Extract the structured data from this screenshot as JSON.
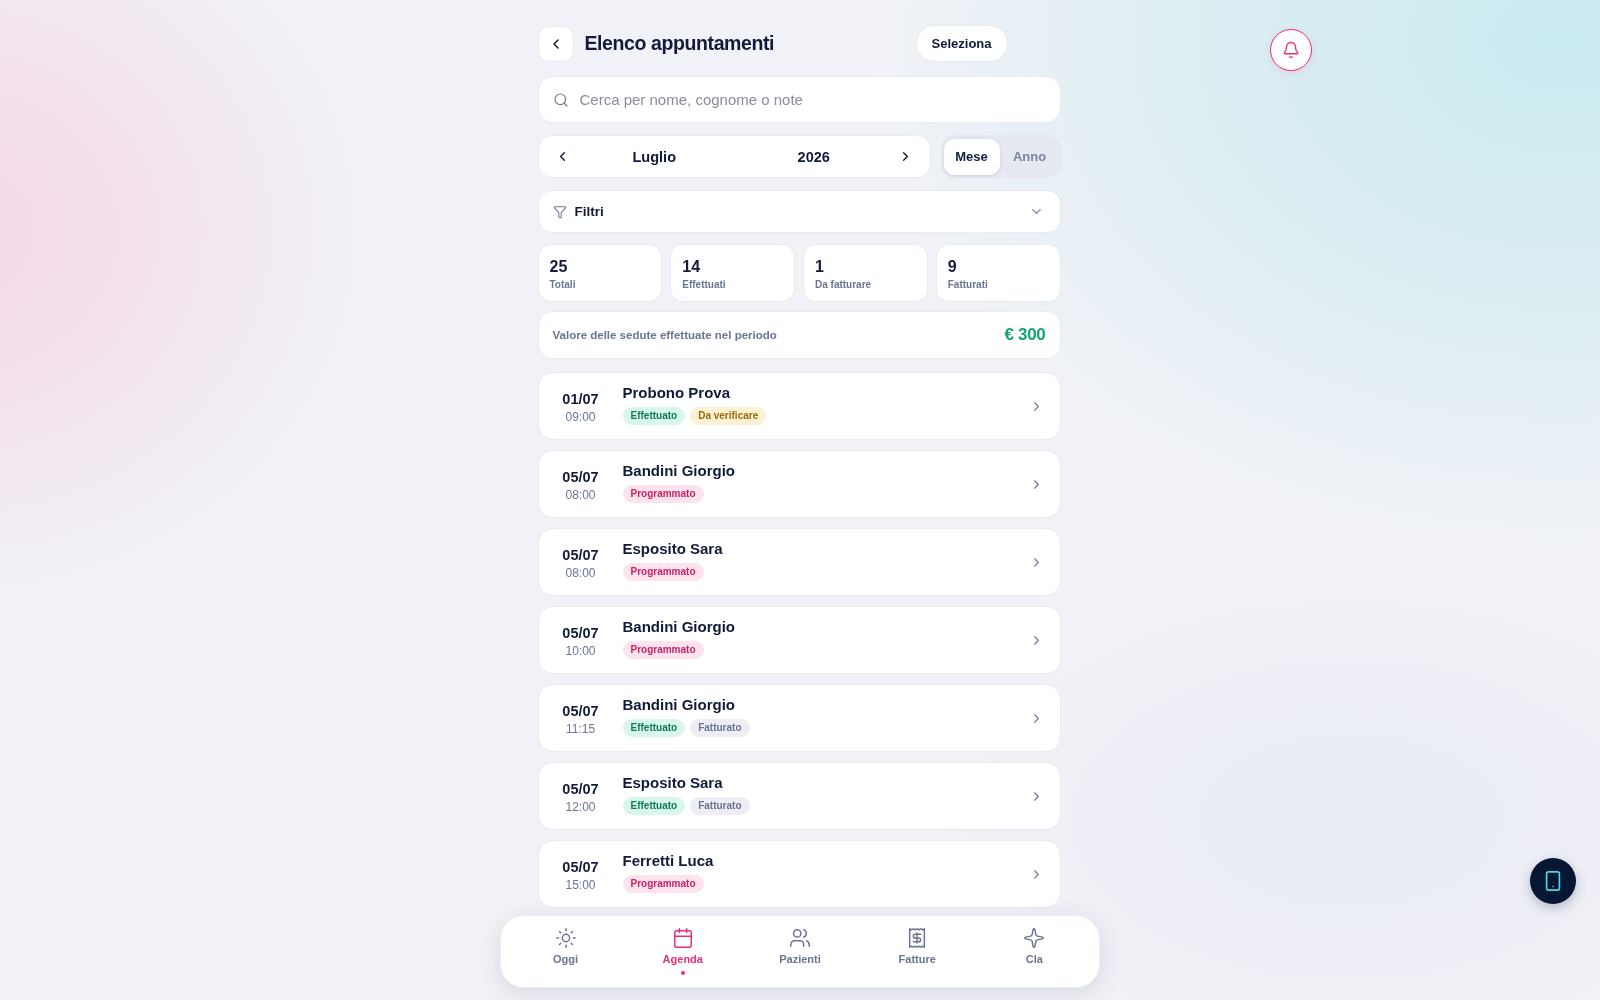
{
  "header": {
    "title": "Elenco appuntamenti",
    "select_button": "Seleziona"
  },
  "search": {
    "placeholder": "Cerca per nome, cognome o note"
  },
  "period": {
    "month": "Luglio",
    "year": "2026",
    "modes": [
      {
        "label": "Mese",
        "selected": true
      },
      {
        "label": "Anno",
        "selected": false
      }
    ]
  },
  "filters": {
    "label": "Filtri",
    "expanded": false
  },
  "stats": [
    {
      "value": "25",
      "label": "Totali"
    },
    {
      "value": "14",
      "label": "Effettuati"
    },
    {
      "value": "1",
      "label": "Da fatturare"
    },
    {
      "value": "9",
      "label": "Fatturati"
    }
  ],
  "summary": {
    "label": "Valore delle sedute effettuate nel periodo",
    "value": "€ 300"
  },
  "appointments": [
    {
      "date": "01/07",
      "time": "09:00",
      "name": "Probono Prova",
      "tags": [
        {
          "label": "Effettuato",
          "kind": "done"
        },
        {
          "label": "Da verificare",
          "kind": "review"
        }
      ]
    },
    {
      "date": "05/07",
      "time": "08:00",
      "name": "Bandini Giorgio",
      "tags": [
        {
          "label": "Programmato",
          "kind": "scheduled"
        }
      ]
    },
    {
      "date": "05/07",
      "time": "08:00",
      "name": "Esposito Sara",
      "tags": [
        {
          "label": "Programmato",
          "kind": "scheduled"
        }
      ]
    },
    {
      "date": "05/07",
      "time": "10:00",
      "name": "Bandini Giorgio",
      "tags": [
        {
          "label": "Programmato",
          "kind": "scheduled"
        }
      ]
    },
    {
      "date": "05/07",
      "time": "11:15",
      "name": "Bandini Giorgio",
      "tags": [
        {
          "label": "Effettuato",
          "kind": "done"
        },
        {
          "label": "Fatturato",
          "kind": "invoiced"
        }
      ]
    },
    {
      "date": "05/07",
      "time": "12:00",
      "name": "Esposito Sara",
      "tags": [
        {
          "label": "Effettuato",
          "kind": "done"
        },
        {
          "label": "Fatturato",
          "kind": "invoiced"
        }
      ]
    },
    {
      "date": "05/07",
      "time": "15:00",
      "name": "Ferretti Luca",
      "tags": [
        {
          "label": "Programmato",
          "kind": "scheduled"
        }
      ]
    }
  ],
  "bottom_nav": [
    {
      "label": "Oggi",
      "selected": false
    },
    {
      "label": "Agenda",
      "selected": true
    },
    {
      "label": "Pazienti",
      "selected": false
    },
    {
      "label": "Fatture",
      "selected": false
    },
    {
      "label": "Cla",
      "selected": false
    }
  ]
}
